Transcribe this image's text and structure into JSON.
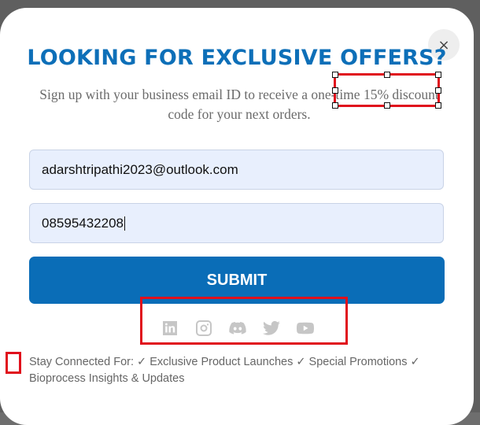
{
  "modal": {
    "close_label": "×",
    "title": "LOOKING FOR EXCLUSIVE OFFERS?",
    "subtitle": "Sign up with your business email ID to receive a one-time 15% discount code for your next orders."
  },
  "form": {
    "email_value": "adarshtripathi2023@outlook.com",
    "phone_value": "08595432208",
    "submit_label": "SUBMIT"
  },
  "social": {
    "icons": [
      "linkedin-icon",
      "instagram-icon",
      "discord-icon",
      "twitter-icon",
      "youtube-icon"
    ]
  },
  "consent": {
    "text": "Stay Connected For: ✓ Exclusive Product Launches ✓ Special Promotions ✓ Bioprocess Insights & Updates"
  },
  "colors": {
    "accent": "#0d6fb8",
    "button": "#0a6db7",
    "annotation_red": "#e0101c",
    "field_bg": "#e8effd"
  }
}
